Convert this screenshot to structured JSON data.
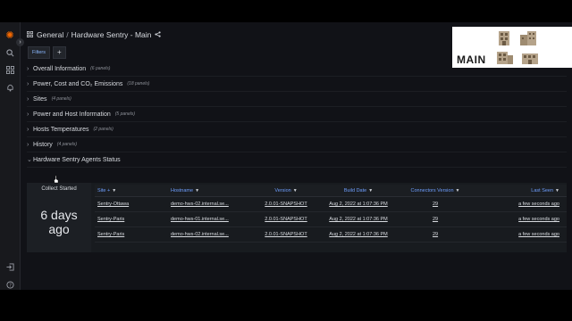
{
  "breadcrumb": {
    "folder": "General",
    "separator": "/",
    "dashboard": "Hardware Sentry - Main"
  },
  "filters": {
    "label": "Filters",
    "add": "+"
  },
  "rows": [
    {
      "title": "Overall Information",
      "count": "(6 panels)"
    },
    {
      "title": "Power, Cost and CO₂ Emissions",
      "count": "(18 panels)"
    },
    {
      "title": "Sites",
      "count": "(4 panels)"
    },
    {
      "title": "Power and Host Information",
      "count": "(5 panels)"
    },
    {
      "title": "Hosts Temperatures",
      "count": "(2 panels)"
    },
    {
      "title": "History",
      "count": "(4 panels)"
    },
    {
      "title": "Hardware Sentry Agents Status",
      "count": ""
    }
  ],
  "stat": {
    "title": "Collect Started",
    "value_line1": "6 days",
    "value_line2": "ago"
  },
  "table": {
    "headers": [
      "Site +",
      "Hostname",
      "Version",
      "Build Date",
      "Connectors Version",
      "Last Seen"
    ],
    "rows": [
      [
        "Sentry-Ottawa",
        "demo-hws-02.internal.se...",
        "2.0.01-SNAPSHOT",
        "Aug 2, 2022 at 1:07:36 PM",
        "29",
        "a few seconds ago"
      ],
      [
        "Sentry-Paris",
        "demo-hws-01.internal.se...",
        "2.0.01-SNAPSHOT",
        "Aug 2, 2022 at 1:07:36 PM",
        "29",
        "a few seconds ago"
      ],
      [
        "Sentry-Paris",
        "demo-hws-02.internal.se...",
        "2.0.01-SNAPSHOT",
        "Aug 2, 2022 at 1:07:36 PM",
        "29",
        "a few seconds ago"
      ]
    ]
  },
  "overlay": {
    "label": "MAIN"
  },
  "colors": {
    "accent_link": "#6e9fff",
    "brand": "#f46800",
    "background": "#111217"
  }
}
